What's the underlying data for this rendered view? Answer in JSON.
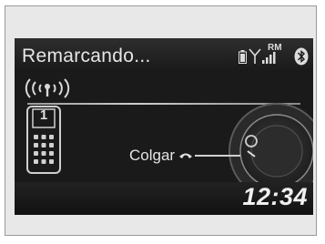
{
  "screen": {
    "title": "Remarcando...",
    "roaming_label": "RM",
    "line_number": "1",
    "hangup_label": "Colgar",
    "clock": "12:34"
  },
  "icons": {
    "status": [
      "battery-icon",
      "signal-strength-icon",
      "bluetooth-icon"
    ],
    "call": [
      "ringing-signal-icon",
      "phone-keypad-icon",
      "hangup-icon",
      "dial-knob-icon"
    ]
  },
  "colors": {
    "background": "#1a1a1a",
    "text": "#e6e6e6"
  }
}
